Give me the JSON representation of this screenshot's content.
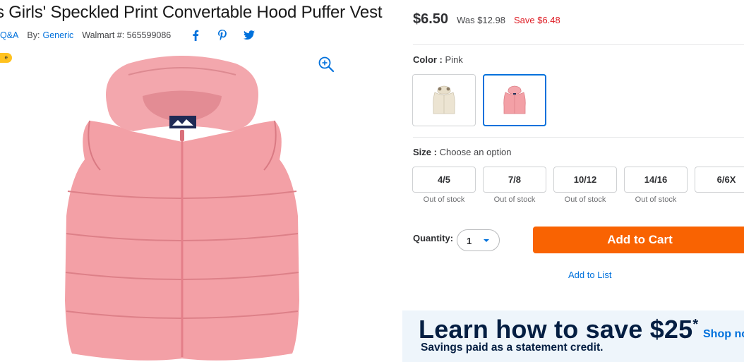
{
  "product": {
    "title": "s Girls' Speckled Print Convertable Hood Puffer Vest",
    "qa_link": "Q&A",
    "by_label": "By:",
    "brand": "Generic",
    "walmart_number": "Walmart #: 565599086",
    "badge": "e"
  },
  "social": [
    "facebook-icon",
    "pinterest-icon",
    "twitter-icon"
  ],
  "pricing": {
    "current": "$6.50",
    "was": "Was $12.98",
    "save": "Save $6.48"
  },
  "color": {
    "label": "Color :",
    "selected": "Pink",
    "options": [
      {
        "name": "Cream",
        "hex": "#ece4d2"
      },
      {
        "name": "Pink",
        "hex": "#f0949c"
      }
    ]
  },
  "size": {
    "label": "Size :",
    "prompt": "Choose an option",
    "options": [
      {
        "label": "4/5",
        "status": "Out of stock"
      },
      {
        "label": "7/8",
        "status": "Out of stock"
      },
      {
        "label": "10/12",
        "status": "Out of stock"
      },
      {
        "label": "14/16",
        "status": "Out of stock"
      },
      {
        "label": "6/6X",
        "status": ""
      }
    ]
  },
  "quantity": {
    "label": "Quantity:",
    "value": "1"
  },
  "actions": {
    "add_to_cart": "Add to Cart",
    "add_to_list": "Add to List"
  },
  "promo": {
    "headline": "Learn how to save $25",
    "asterisk": "*",
    "subtext": "Savings paid as a statement credit.",
    "link": "Shop no"
  },
  "colors": {
    "link_blue": "#0071dc",
    "cart_orange": "#f96302",
    "save_red": "#de1c24",
    "badge_yellow": "#ffc220",
    "vest_pink": "#f0949c",
    "promo_navy": "#041e42"
  }
}
